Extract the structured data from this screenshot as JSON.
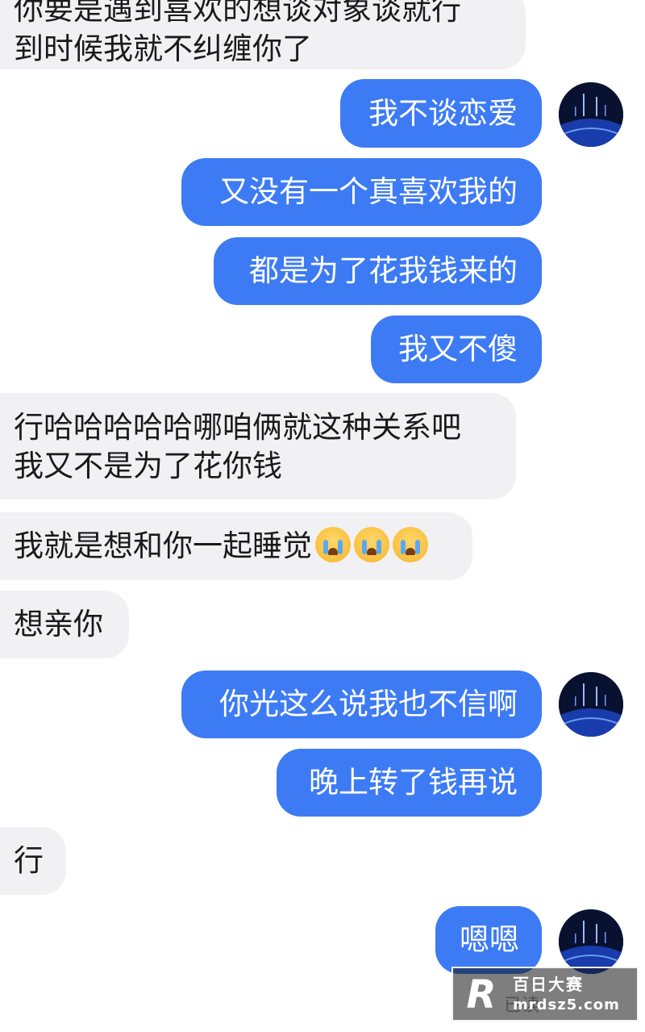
{
  "messages": [
    {
      "side": "in",
      "lines": [
        "你要是遇到喜欢的想谈对象谈就行",
        "到时候我就不纠缠你了"
      ]
    },
    {
      "side": "out",
      "text": "我不谈恋爱"
    },
    {
      "side": "out",
      "text": "又没有一个真喜欢我的"
    },
    {
      "side": "out",
      "text": "都是为了花我钱来的"
    },
    {
      "side": "out",
      "text": "我又不傻"
    },
    {
      "side": "in",
      "lines": [
        "行哈哈哈哈哈哪咱俩就这种关系吧",
        "我又不是为了花你钱"
      ]
    },
    {
      "side": "in",
      "text": "我就是想和你一起睡觉",
      "emoji": "loudly-crying-face x3"
    },
    {
      "side": "in",
      "text": "想亲你"
    },
    {
      "side": "out",
      "text": "你光这么说我也不信啊"
    },
    {
      "side": "out",
      "text": "晚上转了钱再说"
    },
    {
      "side": "in",
      "text": "行"
    },
    {
      "side": "out",
      "text": "嗯嗯"
    }
  ],
  "status": {
    "read": "已读"
  },
  "watermark": {
    "logo": "R",
    "title": "百日大赛",
    "domain": "mrdsz5.com"
  },
  "colors": {
    "outgoing_bubble": "#3d7bf5",
    "incoming_bubble": "#f1f1f3",
    "background": "#ffffff"
  },
  "icons": {
    "avatar": "night-city-lights-avatar",
    "emoji": "loudly-crying-face"
  }
}
